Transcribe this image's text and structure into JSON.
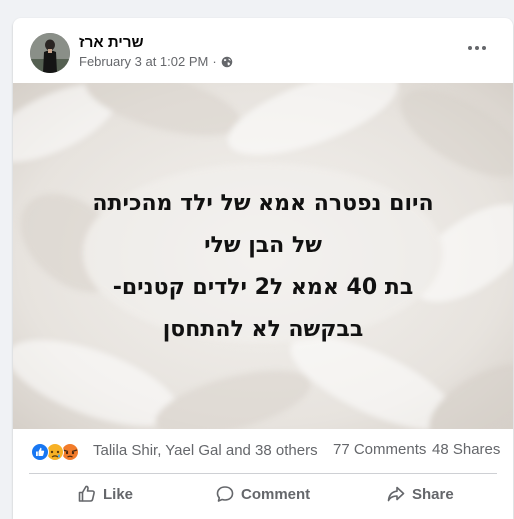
{
  "post": {
    "author": "שרית ארז",
    "date": "February 3 at 1:02 PM",
    "separator": "·",
    "privacy_icon": "globe-icon",
    "more_icon": "more-icon",
    "text_lines": [
      "היום נפטרה אמא של ילד מהכיתה",
      "של הבן שלי",
      "בת 40 אמא ל2 ילדים קטנים-",
      "בבקשה לא להתחסן"
    ]
  },
  "reactions": {
    "icons": [
      "like-reaction-icon",
      "sad-reaction-icon",
      "angry-reaction-icon"
    ],
    "names": "Talila Shir, Yael Gal and 38 others",
    "comments": "77 Comments",
    "shares": "48 Shares"
  },
  "actions": {
    "like": "Like",
    "comment": "Comment",
    "share": "Share"
  },
  "colors": {
    "page_bg": "#f0f2f5",
    "card_bg": "#ffffff",
    "secondary_text": "#65676b",
    "primary_text": "#050505",
    "like_blue": "#1877f2",
    "reaction_yellow": "#f7b125",
    "angry_red": "#e9710f"
  }
}
